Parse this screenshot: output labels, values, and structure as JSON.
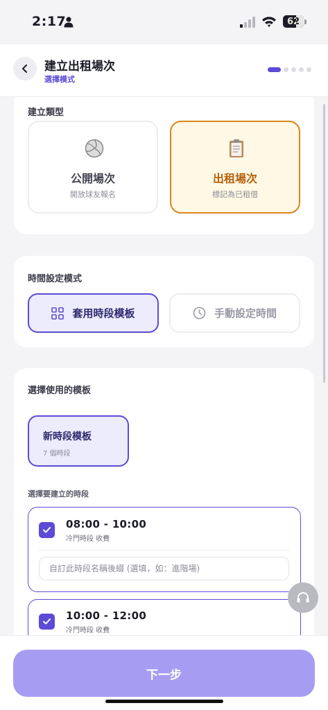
{
  "status_bar": {
    "time": "2:17",
    "battery": "62"
  },
  "header": {
    "title": "建立出租場次",
    "subtitle": "選擇模式",
    "step_total": 5,
    "step_current": 1
  },
  "create_type": {
    "label": "建立類型",
    "options": [
      {
        "title": "公開場次",
        "desc": "開放球友報名",
        "icon": "volleyball-icon",
        "selected": false
      },
      {
        "title": "出租場次",
        "desc": "標記為已租借",
        "icon": "clipboard-icon",
        "selected": true
      }
    ]
  },
  "time_mode": {
    "label": "時間設定模式",
    "options": [
      {
        "label": "套用時段模板",
        "icon": "grid-icon",
        "selected": true
      },
      {
        "label": "手動設定時間",
        "icon": "clock-icon",
        "selected": false
      }
    ]
  },
  "template": {
    "label": "選擇使用的模板",
    "selected": {
      "name": "新時段模板",
      "count": "7 個時段"
    },
    "slots_label": "選擇要建立的時段",
    "slots": [
      {
        "time": "08:00 - 10:00",
        "meta": "冷門時段 收費",
        "checked": true,
        "placeholder": "自訂此時段名稱後綴 (選填，如：進階場)"
      },
      {
        "time": "10:00 - 12:00",
        "meta": "冷門時段 收費",
        "checked": true,
        "placeholder": ""
      }
    ]
  },
  "footer": {
    "next_label": "下一步"
  },
  "colors": {
    "accent": "#5b4bd6",
    "rental_accent": "#d9861b",
    "next_button": "#a69df2"
  }
}
